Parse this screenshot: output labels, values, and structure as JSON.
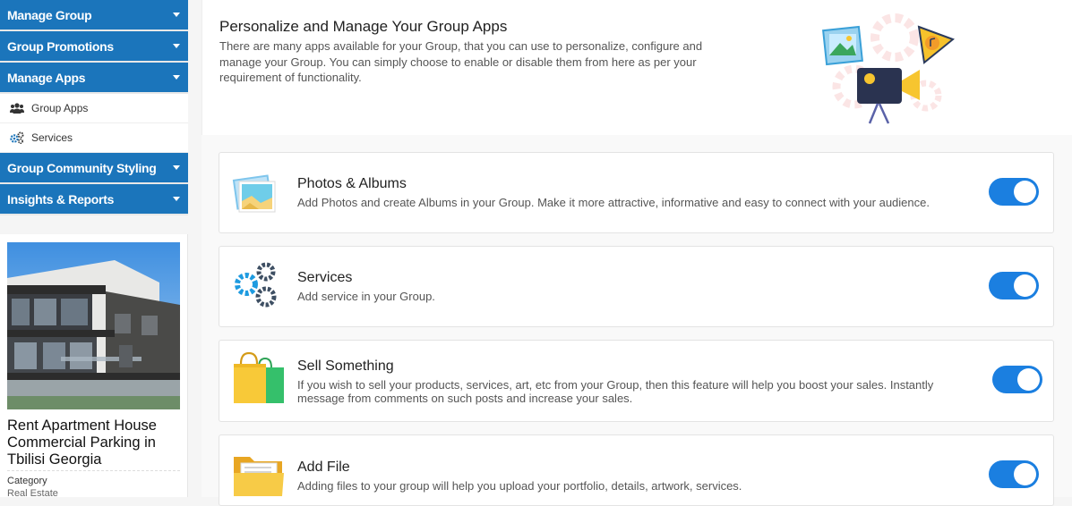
{
  "sidebar": {
    "menu": [
      {
        "label": "Manage Group"
      },
      {
        "label": "Group Promotions"
      },
      {
        "label": "Manage Apps"
      }
    ],
    "sub_items": [
      {
        "label": "Group Apps",
        "icon": "users-icon"
      },
      {
        "label": "Services",
        "icon": "gears-icon"
      }
    ],
    "menu_after": [
      {
        "label": "Group Community Styling"
      },
      {
        "label": "Insights & Reports"
      }
    ],
    "listing": {
      "title": "Rent Apartment House Commercial Parking in Tbilisi Georgia",
      "category_label": "Category",
      "category_value": "Real Estate"
    }
  },
  "hero": {
    "title": "Personalize and Manage Your Group Apps",
    "description": "There are many apps available for your Group, that you can use to personalize, configure and manage your Group. You can simply choose to enable or disable them from here as per your requirement of functionality."
  },
  "apps": [
    {
      "title": "Photos & Albums",
      "description": "Add Photos and create Albums in your Group. Make it more attractive, informative and easy to connect with your audience.",
      "enabled": true,
      "icon": "photos-icon"
    },
    {
      "title": "Services",
      "description": "Add service in your Group.",
      "enabled": true,
      "icon": "gears-icon"
    },
    {
      "title": "Sell Something",
      "description": "If you wish to sell your products, services, art, etc from your Group, then this feature will help you boost your sales. Instantly message from comments on such posts and increase your sales.",
      "enabled": true,
      "icon": "shopping-bags-icon"
    },
    {
      "title": "Add File",
      "description": "Adding files to your group will help you upload your portfolio, details, artwork, services.",
      "enabled": true,
      "icon": "folder-icon"
    }
  ],
  "colors": {
    "accent": "#1b75bb",
    "toggle": "#1b7fe0"
  }
}
